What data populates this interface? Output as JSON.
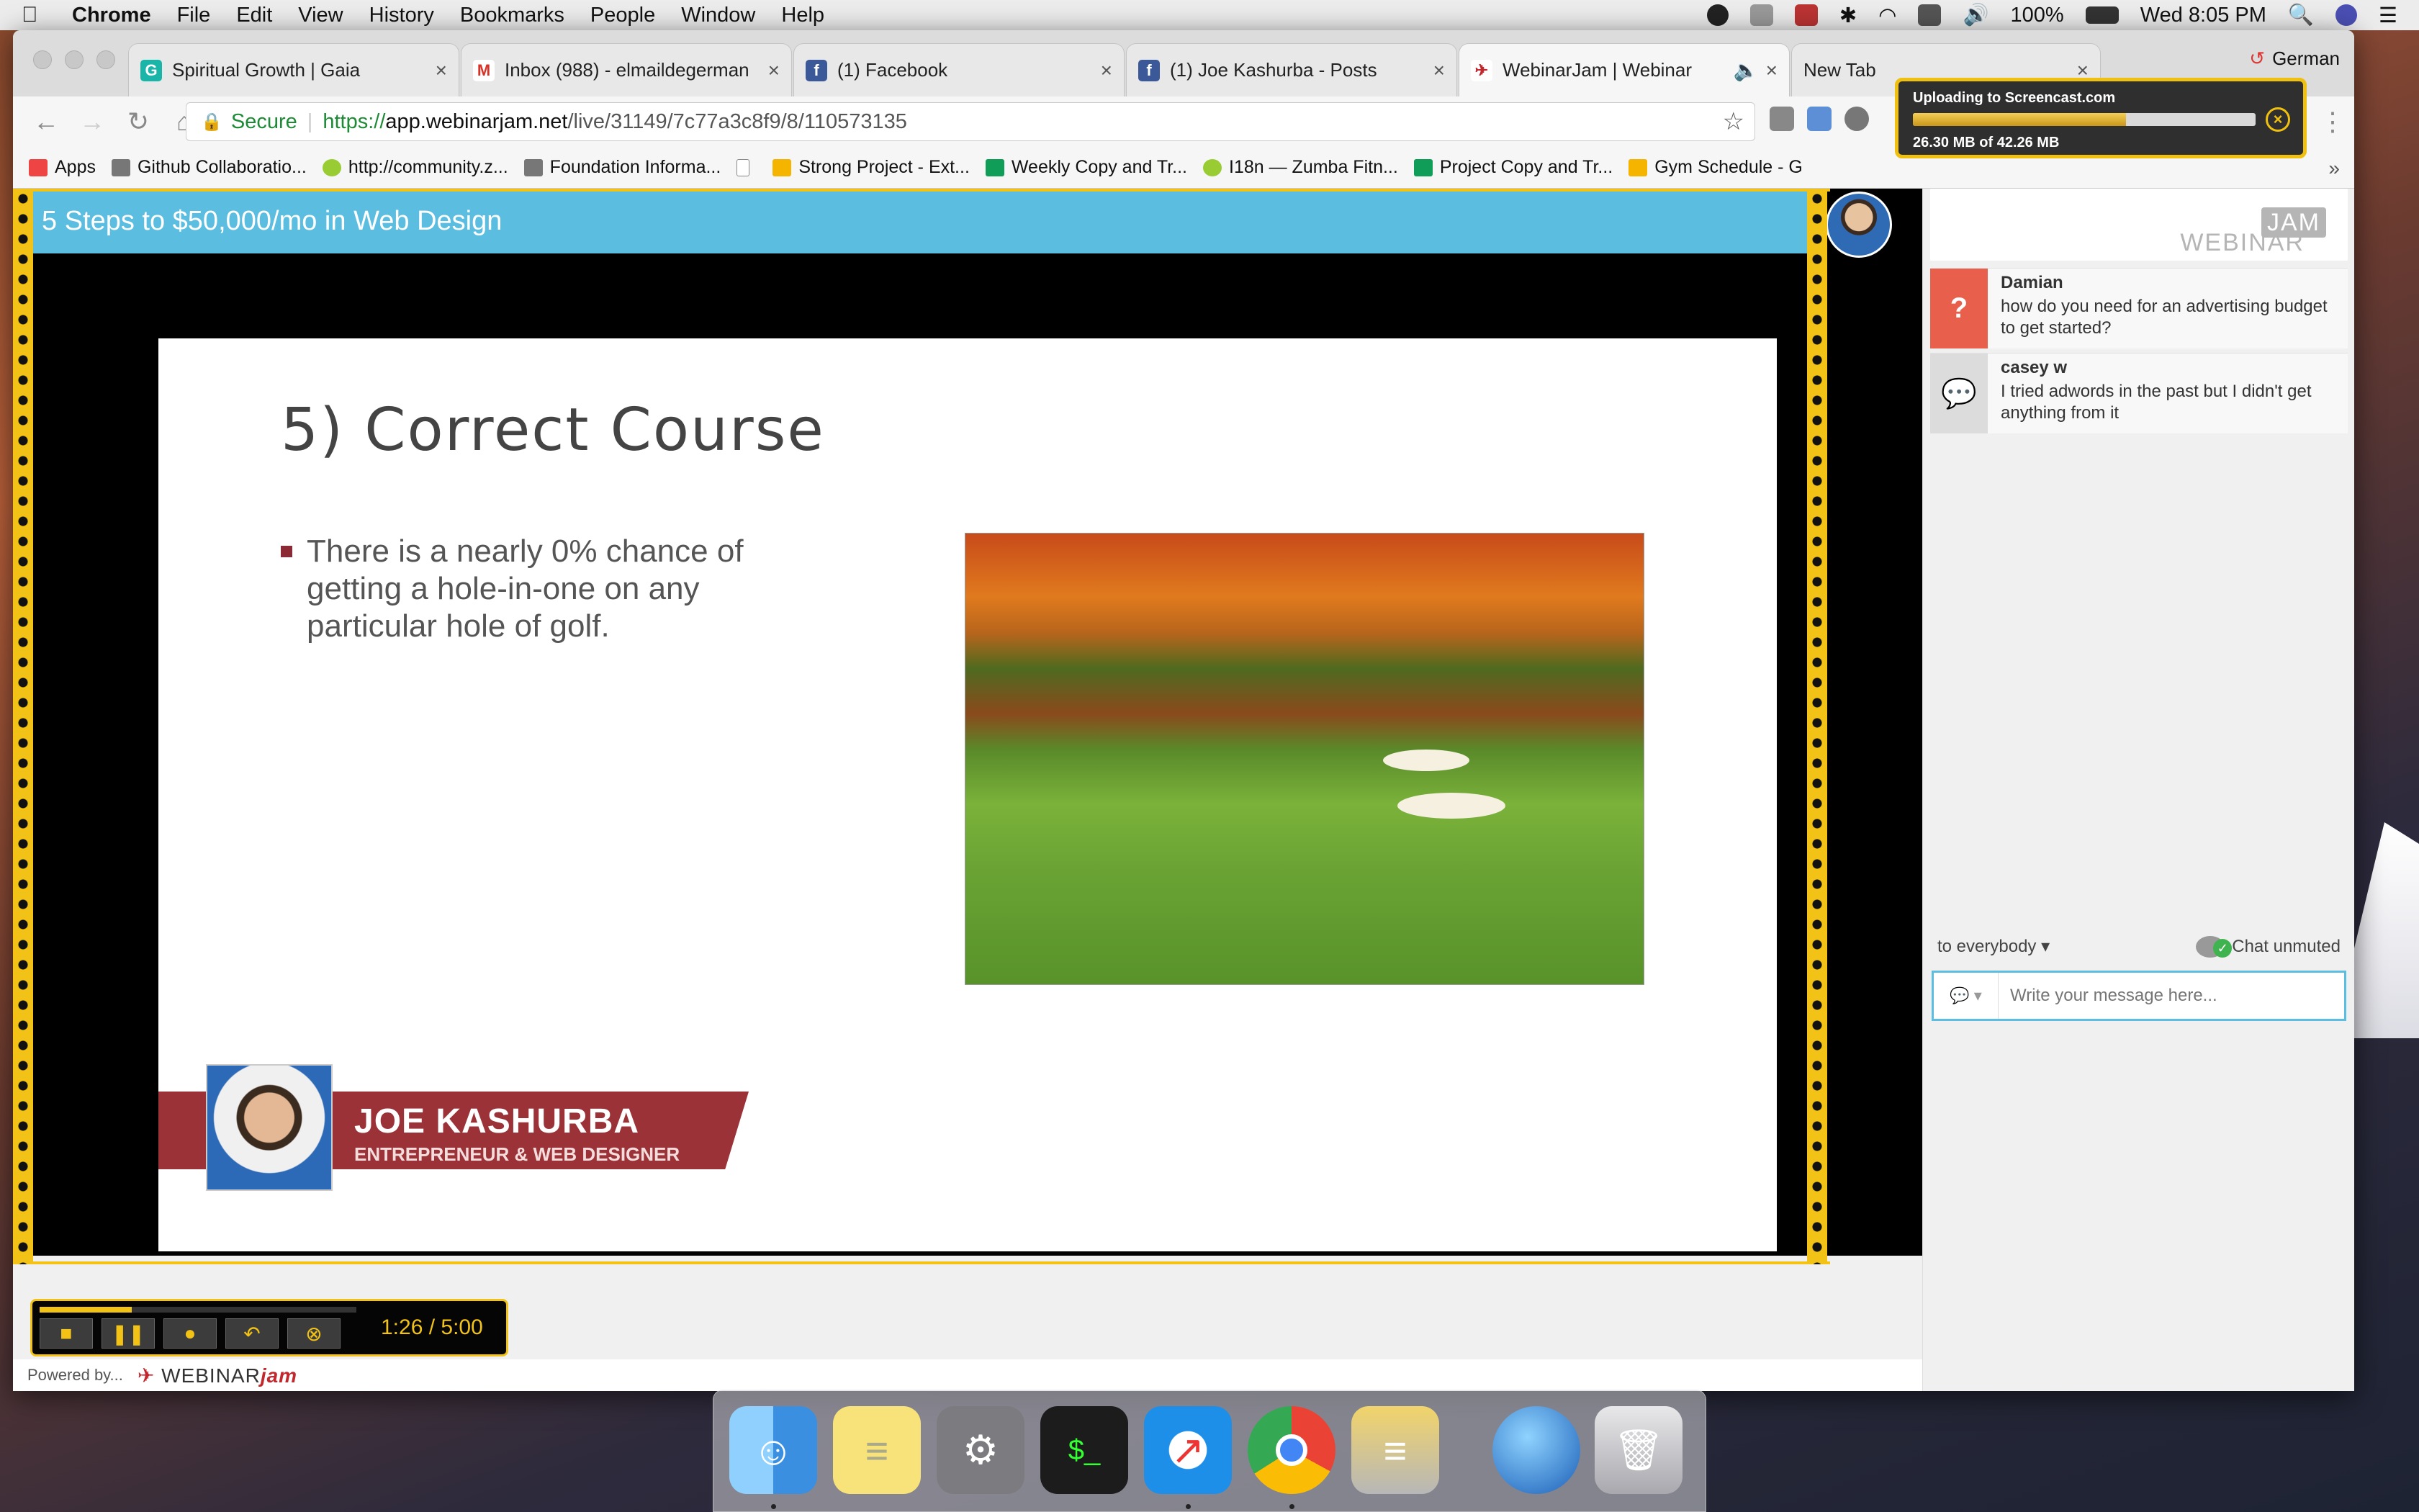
{
  "menubar": {
    "apple": "",
    "app": "Chrome",
    "items": [
      "File",
      "Edit",
      "View",
      "History",
      "Bookmarks",
      "People",
      "Window",
      "Help"
    ],
    "battery": "100%",
    "clock": "Wed 8:05 PM"
  },
  "browser": {
    "tabs": [
      {
        "label": "Spiritual Growth | Gaia",
        "icon": "gaia-icon"
      },
      {
        "label": "Inbox (988) - elmaildegerman",
        "icon": "gmail-icon"
      },
      {
        "label": "(1) Facebook",
        "icon": "facebook-icon"
      },
      {
        "label": "(1) Joe Kashurba - Posts",
        "icon": "facebook-icon"
      },
      {
        "label": "WebinarJam | Webinar",
        "icon": "webinarjam-icon"
      },
      {
        "label": "New Tab",
        "icon": ""
      }
    ],
    "profile": "German",
    "security_label": "Secure",
    "url_proto": "https://",
    "url_host": "app.webinarjam.net",
    "url_path": "/live/31149/7c77a3c8f9/8/110573135"
  },
  "bookmarks": [
    "Apps",
    "Github Collaboratio...",
    "http://community.z...",
    "Foundation Informa...",
    "",
    "Strong Project - Ext...",
    "Weekly Copy and Tr...",
    "I18n — Zumba Fitn...",
    "Project Copy and Tr...",
    "Gym Schedule - G"
  ],
  "upload": {
    "title": "Uploading to Screencast.com",
    "status": "26.30 MB of 42.26 MB",
    "progress": 0.622
  },
  "webinar": {
    "title": "5 Steps to $50,000/mo in Web Design",
    "slide_title": "5) Correct Course",
    "bullet": "There is a nearly 0% chance of getting a hole-in-one on any particular hole of golf.",
    "presenter_name": "JOE KASHURBA",
    "presenter_role": "ENTREPRENEUR & WEB DESIGNER",
    "time": "1:26 / 5:00",
    "playback_progress": 0.29,
    "powered_by": "Powered by...",
    "powered_logo": "WEBINAR",
    "powered_logo_jam": "jam"
  },
  "chat": {
    "brand": "WEBINAR",
    "brand_jam": "JAM",
    "messages": [
      {
        "author": "Damian",
        "text": "how do you need for an advertising budget to get started?",
        "type": "question"
      },
      {
        "author": "casey w",
        "text": "I tried adwords in the past but I didn't get anything from it",
        "type": "chat"
      }
    ],
    "audience": "to everybody",
    "mute_status": "Chat unmuted",
    "placeholder": "Write your message here..."
  },
  "dock": [
    "Finder",
    "Notes",
    "System Preferences",
    "Terminal",
    "Safari",
    "Chrome",
    "Sequel Pro",
    "Network",
    "Trash"
  ],
  "colors": {
    "header": "#5bbddf",
    "accent_yellow": "#f2c316",
    "presenter_bar": "#9b3238",
    "question_badge": "#e8604c"
  }
}
